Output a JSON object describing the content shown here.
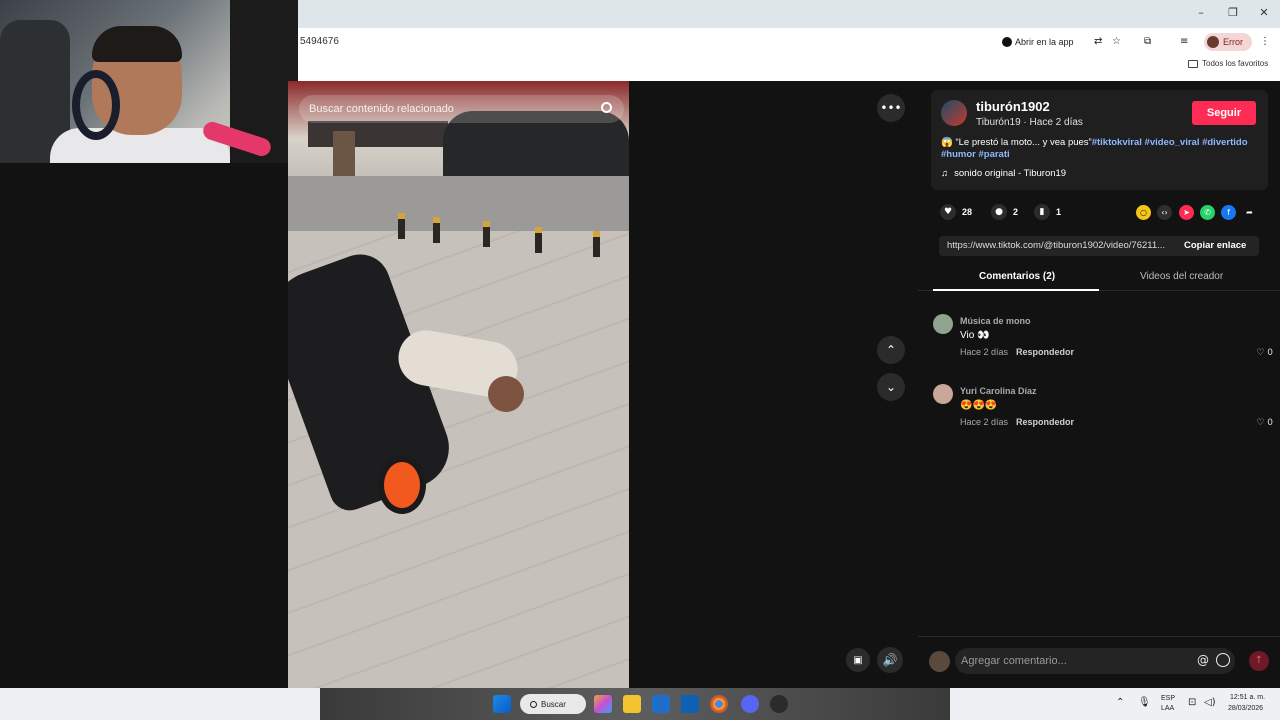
{
  "browser": {
    "url_fragment": "5494676",
    "open_app_label": "Abrir en la app",
    "profile_label": "Error",
    "bookmarks_label": "Todos los favoritos"
  },
  "video": {
    "search_placeholder": "Buscar contenido relacionado"
  },
  "author": {
    "name": "tiburón1902",
    "subtitle": "Tiburón19 · Hace 2 días",
    "follow_label": "Seguir"
  },
  "caption": {
    "emoji": "😱",
    "text": " “Le prestó la moto... y vea pues”",
    "tags": [
      "#tiktokviral",
      "#video_viral",
      "#divertido",
      "#humor",
      "#parati"
    ]
  },
  "music": {
    "icon": "♫",
    "label": "sonido original - Tiburon19"
  },
  "actions": {
    "likes": "28",
    "comments": "2",
    "saves": "1"
  },
  "share_link": {
    "url": "https://www.tiktok.com/@tiburon1902/video/76211...",
    "copy_label": "Copiar enlace"
  },
  "tabs": {
    "comments": "Comentarios (2)",
    "creator_videos": "Videos del creador"
  },
  "comments": [
    {
      "author": "Música de mono",
      "text": "Vio 👀",
      "time": "Hace 2 días",
      "reply": "Respondedor",
      "likes": "0",
      "avatar_color": "#8fa38f"
    },
    {
      "author": "Yuri Carolina Díaz",
      "text": "😍😍😍",
      "time": "Hace 2 días",
      "reply": "Respondedor",
      "likes": "0",
      "avatar_color": "#c9a79a"
    }
  ],
  "comment_input": {
    "placeholder": "Agregar comentario..."
  },
  "taskbar": {
    "search_label": "Buscar",
    "lang": "ESP",
    "lang_sub": "LAA",
    "time": "12:51 a. m.",
    "date": "28/03/2026"
  },
  "colors": {
    "accent": "#fe2c55",
    "tag_color": "#8fb8ff",
    "panel_bg": "#121212"
  }
}
